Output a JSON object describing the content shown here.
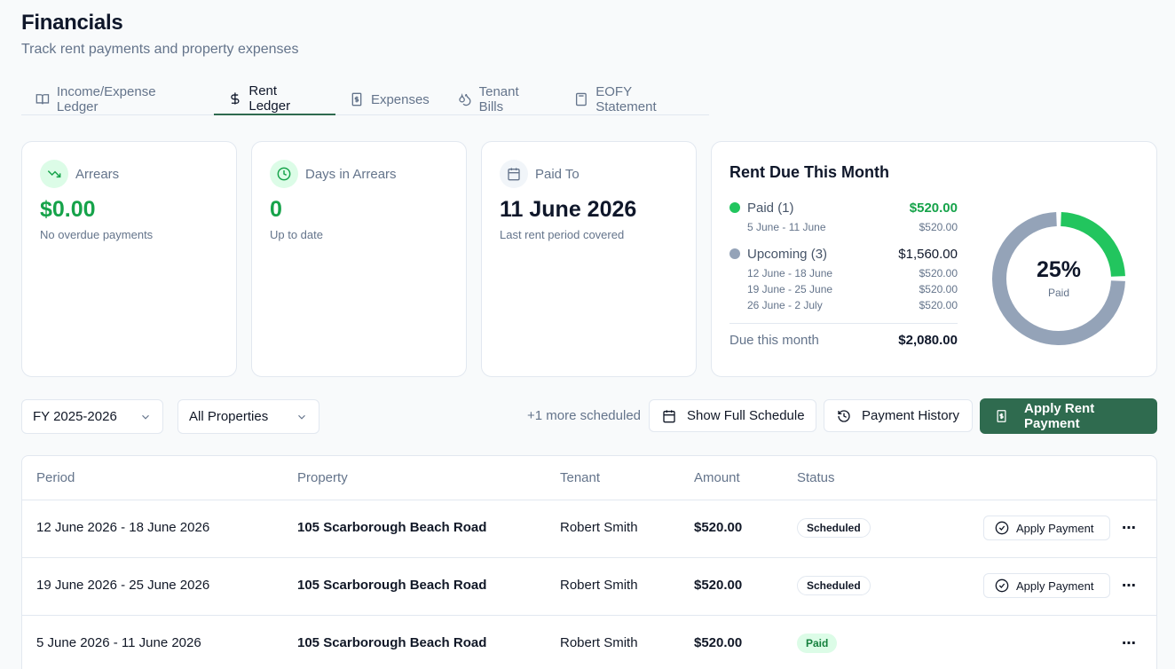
{
  "header": {
    "title": "Financials",
    "subtitle": "Track rent payments and property expenses"
  },
  "tabs": [
    {
      "label": "Income/Expense Ledger",
      "icon": "book-icon"
    },
    {
      "label": "Rent Ledger",
      "icon": "dollar-icon",
      "active": true
    },
    {
      "label": "Expenses",
      "icon": "receipt-icon"
    },
    {
      "label": "Tenant Bills",
      "icon": "drops-icon"
    },
    {
      "label": "EOFY Statement",
      "icon": "calculator-icon"
    }
  ],
  "kpis": {
    "arrears": {
      "label": "Arrears",
      "value": "$0.00",
      "note": "No overdue payments"
    },
    "days": {
      "label": "Days in Arrears",
      "value": "0",
      "note": "Up to date"
    },
    "paid_to": {
      "label": "Paid To",
      "value": "11 June 2026",
      "note": "Last rent period covered"
    }
  },
  "rent_due": {
    "title": "Rent Due This Month",
    "paid": {
      "label": "Paid (1)",
      "amount": "$520.00",
      "items": [
        {
          "period": "5 June - 11 June",
          "amount": "$520.00"
        }
      ]
    },
    "upcoming": {
      "label": "Upcoming (3)",
      "amount": "$1,560.00",
      "items": [
        {
          "period": "12 June - 18 June",
          "amount": "$520.00"
        },
        {
          "period": "19 June - 25 June",
          "amount": "$520.00"
        },
        {
          "period": "26 June - 2 July",
          "amount": "$520.00"
        }
      ]
    },
    "total_label": "Due this month",
    "total": "$2,080.00",
    "percent": "25%",
    "percent_label": "Paid",
    "paid_fraction": 0.25,
    "colors": {
      "paid": "#22c55e",
      "upcoming": "#94a3b8"
    }
  },
  "toolbar": {
    "fy": "FY 2025-2026",
    "property": "All Properties",
    "more_scheduled": "+1 more scheduled",
    "schedule_btn": "Show Full Schedule",
    "history_btn": "Payment History",
    "apply_btn": "Apply Rent Payment"
  },
  "table": {
    "headers": [
      "Period",
      "Property",
      "Tenant",
      "Amount",
      "Status"
    ],
    "apply_label": "Apply Payment",
    "rows": [
      {
        "period": "12 June 2026 - 18 June 2026",
        "property": "105 Scarborough Beach Road",
        "tenant": "Robert Smith",
        "amount": "$520.00",
        "status": "Scheduled"
      },
      {
        "period": "19 June 2026 - 25 June 2026",
        "property": "105 Scarborough Beach Road",
        "tenant": "Robert Smith",
        "amount": "$520.00",
        "status": "Scheduled"
      },
      {
        "period": "5 June 2026 - 11 June 2026",
        "property": "105 Scarborough Beach Road",
        "tenant": "Robert Smith",
        "amount": "$520.00",
        "status": "Paid"
      }
    ]
  }
}
